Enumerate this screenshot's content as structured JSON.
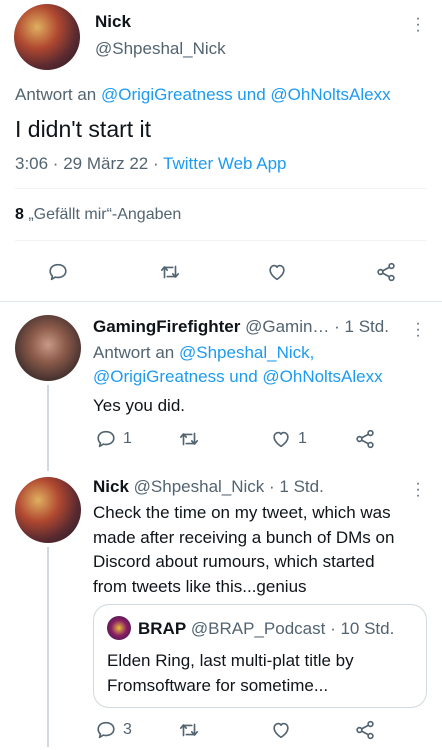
{
  "main_tweet": {
    "display_name": "Nick",
    "handle": "@Shpeshal_Nick",
    "reply_prefix": "Antwort an ",
    "reply_targets": "@OrigiGreatness und @OhNoltsAlexx",
    "text": "I didn't start it",
    "time": "3:06 · 29 März 22 · ",
    "client": "Twitter Web App",
    "likes_count": "8",
    "likes_label": " „Gefällt mir“-Angaben"
  },
  "replies": [
    {
      "display_name": "GamingFirefighter",
      "handle": "@Gamin…",
      "time": " · 1 Std.",
      "reply_prefix": "Antwort an ",
      "reply_line1": "@Shpeshal_Nick,",
      "reply_line2": "@OrigiGreatness und @OhNoltsAlexx",
      "text": "Yes you did.",
      "reply_count": "1",
      "like_count": "1"
    },
    {
      "display_name": "Nick",
      "handle": "@Shpeshal_Nick",
      "time": " · 1 Std.",
      "text_lines": [
        "Check the time on my tweet, which was",
        "made after receiving a bunch of DMs on",
        "Discord about rumours, which started",
        "from tweets like this...genius"
      ],
      "reply_count": "3",
      "quote": {
        "display_name": "BRAP",
        "handle": "@BRAP_Podcast",
        "time": " · 10 Std.",
        "text_lines": [
          "Elden Ring, last multi-plat title by",
          "Fromsoftware for sometime..."
        ]
      }
    }
  ],
  "icons": [
    "more-icon",
    "reply-icon",
    "retweet-icon",
    "like-icon",
    "share-icon"
  ],
  "colors": {
    "link": "#1d9bf0",
    "secondary": "#536471",
    "divider": "#eff3f4"
  }
}
